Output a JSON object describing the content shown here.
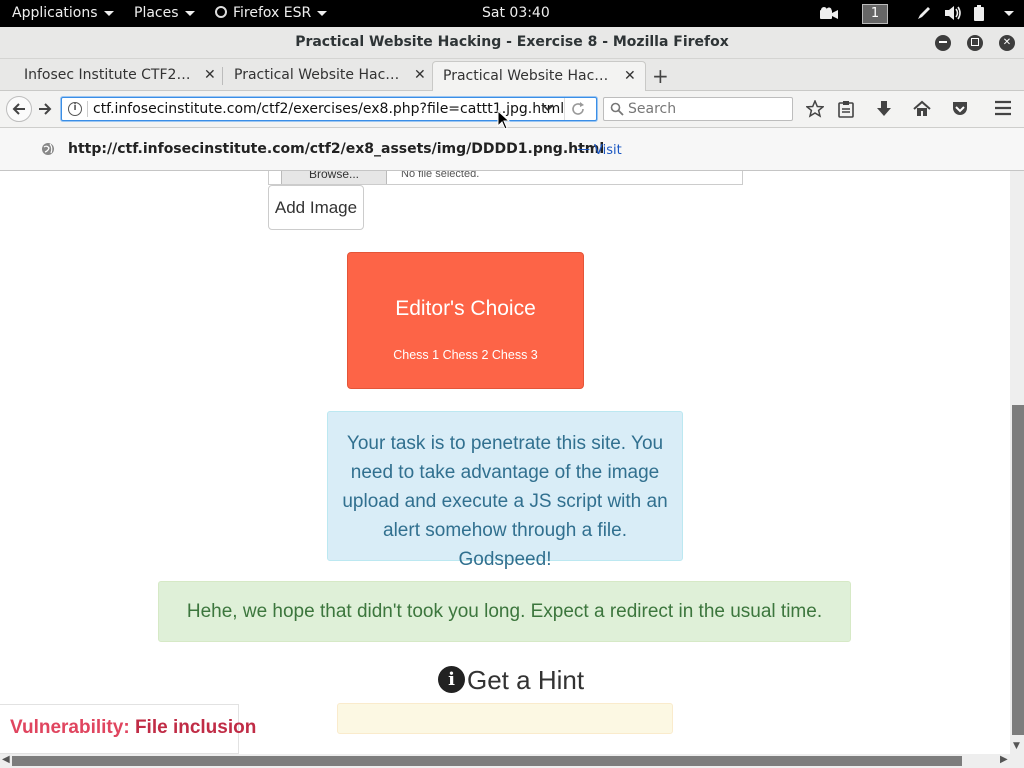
{
  "topbar": {
    "applications": "Applications",
    "places": "Places",
    "browser_menu": "Firefox ESR",
    "clock": "Sat 03:40",
    "workspace": "1"
  },
  "window": {
    "title": "Practical Website Hacking - Exercise 8 - Mozilla Firefox"
  },
  "tabs": [
    {
      "label": "Infosec Institute CTF2 Pr...",
      "active": false
    },
    {
      "label": "Practical Website Hackin...",
      "active": false
    },
    {
      "label": "Practical Website Hackin...",
      "active": true
    }
  ],
  "navbar": {
    "url": "ctf.infosecinstitute.com/ctf2/exercises/ex8.php?file=cattt1.jpg.html",
    "search_placeholder": "Search"
  },
  "url_popup": {
    "suggestion": "http://ctf.infosecinstitute.com/ctf2/ex8_assets/img/DDDD1.png.html",
    "dash": "—",
    "action": "Visit"
  },
  "page": {
    "browse_label": "Browse...",
    "no_file": "No file selected.",
    "add_image": "Add Image",
    "editor_card": {
      "heading": "Editor's Choice",
      "subtext": "Chess 1 Chess 2 Chess 3"
    },
    "task_text": "Your task is to penetrate this site. You need to take advantage of the image upload and execute a JS script with an alert somehow through a file. Godspeed!",
    "success_text": "Hehe, we hope that didn't took you long. Expect a redirect in the usual time.",
    "hint_title": "Get a Hint",
    "vulnerability_label": "Vulnerability:",
    "vulnerability_value": "File inclusion"
  },
  "colors": {
    "editor_card_bg": "#fd6447",
    "info_bg": "#d9edf7",
    "success_bg": "#dff0d8",
    "warning_bg": "#fcf8e3",
    "vuln_text": "#e0455f"
  },
  "icons": {
    "back": "back-arrow-icon",
    "forward": "forward-arrow-icon",
    "site_info": "info-icon",
    "reload": "reload-icon",
    "bookmark": "star-icon",
    "reader": "clipboard-icon",
    "downloads": "download-icon",
    "home": "home-icon",
    "pocket": "pocket-icon",
    "menu": "hamburger-icon",
    "hint": "info-circle-icon"
  }
}
